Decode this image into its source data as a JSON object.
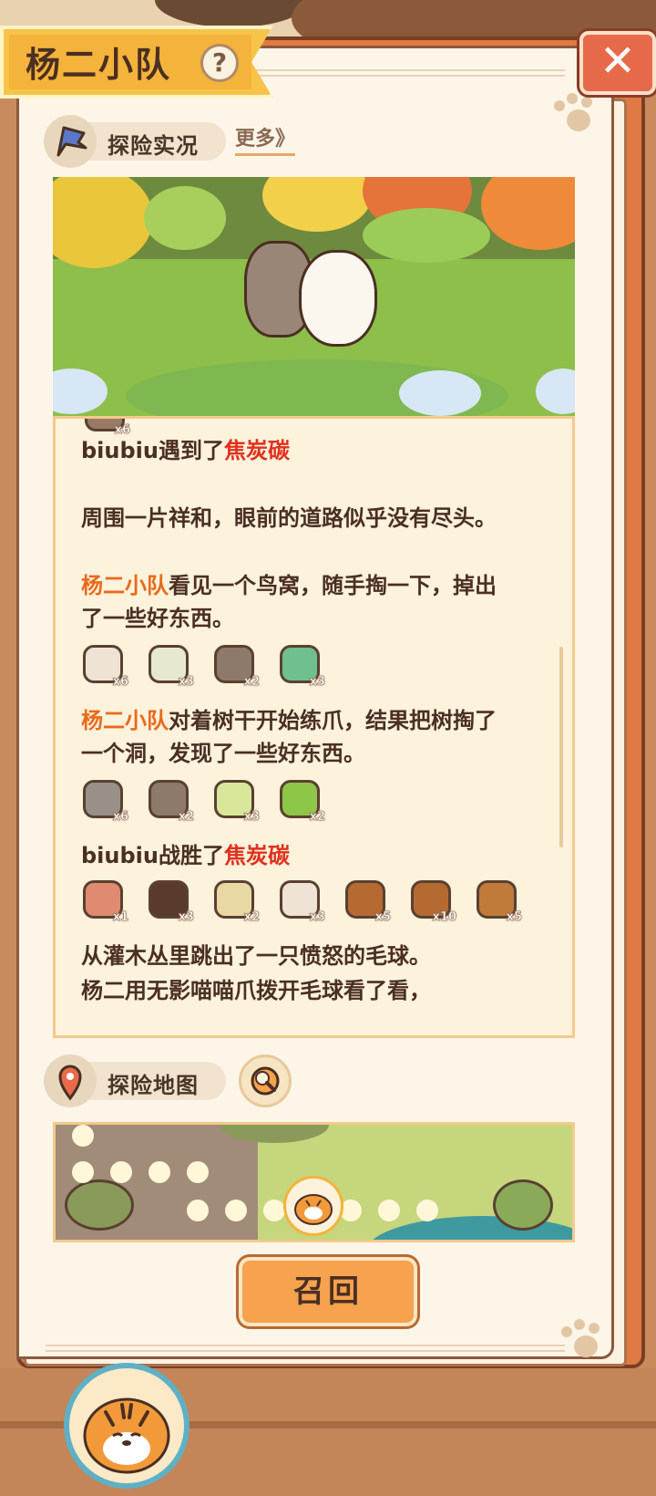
{
  "header": {
    "title": "杨二小队",
    "help_label": "?",
    "close_label": "✕"
  },
  "live_section": {
    "label": "探险实况",
    "more_label": "更多》",
    "icon": "flag-icon"
  },
  "log": {
    "partial_top_qty": "x6",
    "entries": [
      {
        "segments": [
          {
            "text": "biubiu遇到了",
            "style": "normal"
          },
          {
            "text": "焦炭碳",
            "style": "red"
          }
        ]
      },
      {
        "segments": [
          {
            "text": "周围一片祥和，眼前的道路似乎没有尽头。",
            "style": "normal"
          }
        ]
      },
      {
        "segments": [
          {
            "text": "杨二小队",
            "style": "orange"
          },
          {
            "text": "看见一个鸟窝，随手掏一下，掉出",
            "style": "normal"
          }
        ]
      },
      {
        "segments": [
          {
            "text": "了一些好东西。",
            "style": "normal"
          }
        ]
      },
      {
        "segments": [
          {
            "text": "杨二小队",
            "style": "orange"
          },
          {
            "text": "对着树干开始练爪，结果把树掏了",
            "style": "normal"
          }
        ]
      },
      {
        "segments": [
          {
            "text": "一个洞，发现了一些好东西。",
            "style": "normal"
          }
        ]
      },
      {
        "segments": [
          {
            "text": "biubiu战胜了",
            "style": "normal"
          },
          {
            "text": "焦炭碳",
            "style": "red"
          }
        ]
      },
      {
        "segments": [
          {
            "text": "从灌木丛里跳出了一只愤怒的毛球。",
            "style": "normal"
          }
        ]
      },
      {
        "segments": [
          {
            "text": "杨二用无影喵喵爪拨开毛球看了看，",
            "style": "normal"
          }
        ]
      }
    ],
    "item_rows": [
      {
        "items": [
          {
            "icon": "mushroom-box-icon",
            "qty": "x6"
          },
          {
            "icon": "paper-stack-icon",
            "qty": "x3"
          },
          {
            "icon": "log-icon",
            "qty": "x2"
          },
          {
            "icon": "cloth-icon",
            "qty": "x3"
          }
        ]
      },
      {
        "items": [
          {
            "icon": "rock-icon",
            "qty": "x6"
          },
          {
            "icon": "log-icon",
            "qty": "x2"
          },
          {
            "icon": "cabbage-icon",
            "qty": "x3"
          },
          {
            "icon": "leaf-icon",
            "qty": "x2"
          }
        ]
      },
      {
        "items": [
          {
            "icon": "meat-icon",
            "qty": "x1"
          },
          {
            "icon": "jar-icon",
            "qty": "x3"
          },
          {
            "icon": "yarn-icon",
            "qty": "x2"
          },
          {
            "icon": "mushroom-box-icon",
            "qty": "x3"
          },
          {
            "icon": "bear-icon",
            "qty": "x5"
          },
          {
            "icon": "cow-icon",
            "qty": "x10"
          },
          {
            "icon": "monkey-icon",
            "qty": "x5"
          }
        ]
      }
    ]
  },
  "map_section": {
    "label": "探险地图",
    "icon": "location-pin-icon",
    "search_icon": "magnifier-icon"
  },
  "recall_label": "召回",
  "colors": {
    "accent_orange": "#f6a24e",
    "highlight_red": "#e0301c",
    "highlight_orange": "#e86a1a",
    "paper": "#fdf6e8"
  }
}
